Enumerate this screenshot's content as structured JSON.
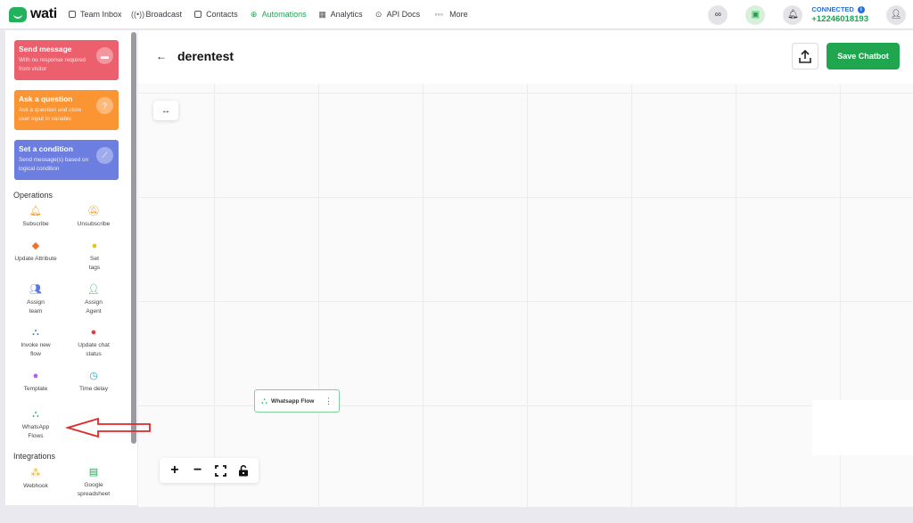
{
  "app": {
    "logo_text": "wati"
  },
  "nav": {
    "items": [
      {
        "label": "Team Inbox",
        "icon": "inbox-icon"
      },
      {
        "label": "Broadcast",
        "icon": "broadcast-icon"
      },
      {
        "label": "Contacts",
        "icon": "contacts-icon"
      },
      {
        "label": "Automations",
        "icon": "automations-icon",
        "active": true
      },
      {
        "label": "Analytics",
        "icon": "analytics-icon"
      },
      {
        "label": "API Docs",
        "icon": "api-docs-icon"
      },
      {
        "label": "More",
        "icon": "more-icon"
      }
    ],
    "active_color": "#22a355"
  },
  "status": {
    "connected_label": "CONNECTED",
    "phone": "+12246018193"
  },
  "sidebar": {
    "cards": [
      {
        "title": "Send message",
        "desc": "With no response required from visitor",
        "color": "#ec5f6d"
      },
      {
        "title": "Ask a question",
        "desc": "Ask a question and store user input in variable",
        "color": "#fb9433"
      },
      {
        "title": "Set a condition",
        "desc": "Send message(s) based on logical condition",
        "color": "#6c7fe0"
      }
    ],
    "operations_title": "Operations",
    "operations": [
      {
        "label": "Subscribe",
        "icon": "bell-icon"
      },
      {
        "label": "Unsubscribe",
        "icon": "bell-off-icon"
      },
      {
        "label": "Update Attribute",
        "icon": "tag-icon"
      },
      {
        "label": "Set tags",
        "icon": "bulb-icon"
      },
      {
        "label": "Assign team",
        "icon": "team-icon"
      },
      {
        "label": "Assign Agent",
        "icon": "agent-icon"
      },
      {
        "label": "Invoke new flow",
        "icon": "flow-icon"
      },
      {
        "label": "Update chat status",
        "icon": "chat-status-icon"
      },
      {
        "label": "Template",
        "icon": "template-icon"
      },
      {
        "label": "Time delay",
        "icon": "clock-icon"
      },
      {
        "label": "WhatsApp Flows",
        "icon": "whatsapp-flows-icon"
      }
    ],
    "integrations_title": "Integrations",
    "integrations": [
      {
        "label": "Webhook",
        "icon": "webhook-icon"
      },
      {
        "label": "Google spreadsheet",
        "icon": "spreadsheet-icon"
      }
    ]
  },
  "editor": {
    "title": "derentest",
    "save_label": "Save Chatbot",
    "node_label": "Whatsapp Flow",
    "save_color": "#21a650"
  }
}
